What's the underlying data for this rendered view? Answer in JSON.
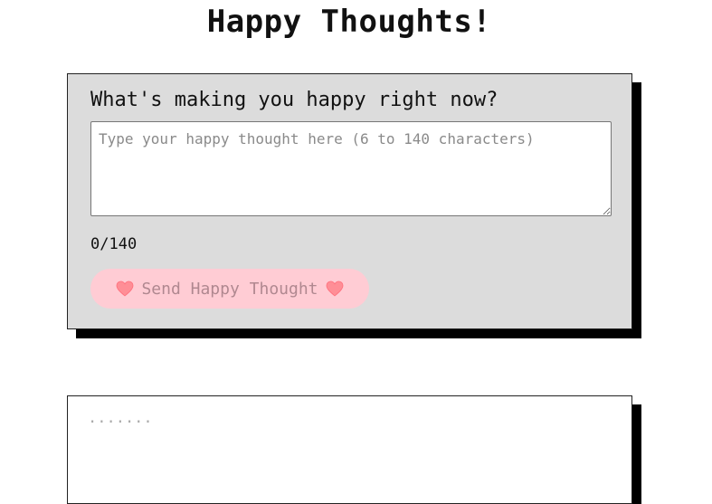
{
  "page": {
    "title": "Happy Thoughts!"
  },
  "form": {
    "heading": "What's making you happy right now?",
    "textarea": {
      "value": "",
      "placeholder": "Type your happy thought here (6 to 140 characters)"
    },
    "counter": "0/140",
    "send_button": {
      "label": "Send Happy Thought",
      "icon_left": "heart-icon",
      "icon_right": "heart-icon",
      "disabled": true
    }
  },
  "thought_list": {
    "first_item_text": "......."
  },
  "colors": {
    "card_background": "#dcdcdc",
    "card_shadow": "#000000",
    "button_background": "#ffccd4",
    "heart": "#ff7b84"
  }
}
